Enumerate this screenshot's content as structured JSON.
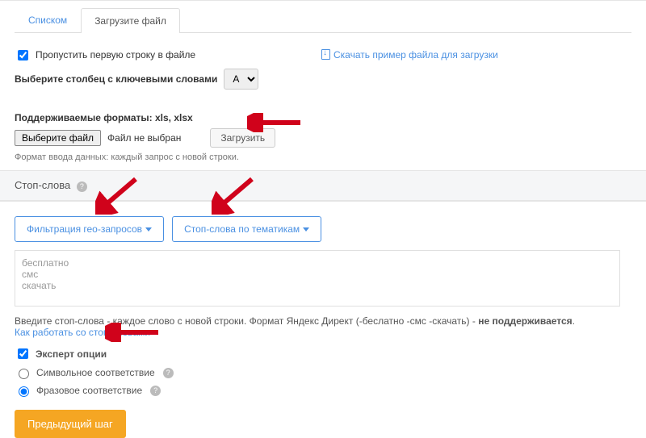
{
  "tabs": {
    "list": "Списком",
    "upload": "Загрузите файл"
  },
  "skip_first": "Пропустить первую строку в файле",
  "download_example": "Скачать пример файла для загрузки",
  "select_col_label": "Выберите столбец с ключевыми словами",
  "col_value": "A",
  "formats_label": "Поддерживаемые форматы: xls, xlsx",
  "choose_file": "Выберите файл",
  "no_file": "Файл не выбран",
  "upload_btn": "Загрузить",
  "format_hint": "Формат ввода данных: каждый запрос с новой строки.",
  "stop_header": "Стоп-слова",
  "geo_btn": "Фильтрация гео-запросов",
  "theme_btn": "Стоп-слова по тематикам",
  "stopwords_value": "бесплатно\nсмс\nскачать",
  "stop_note_a": "Введите стоп-слова - каждое слово с новой строки. Формат Яндекс Директ (-беслатно -смс -скачать) - ",
  "stop_note_b": "не поддерживается",
  "stop_link": "Как работать со стоп-словами",
  "expert_label": "Эксперт опции",
  "opt_symbol": "Символьное соответствие",
  "opt_phrase": "Фразовое соответствие",
  "prev_step": "Предыдущий шаг"
}
